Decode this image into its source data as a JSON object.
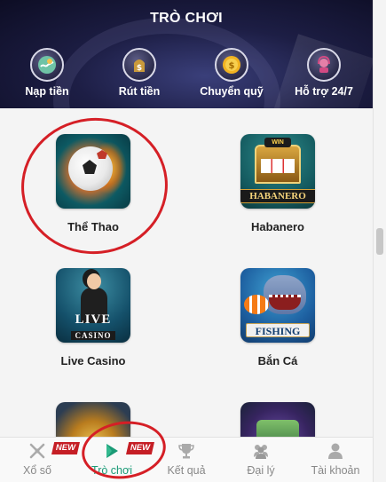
{
  "header": {
    "title": "TRÒ CHƠI",
    "actions": [
      {
        "label": "Nạp tiền",
        "icon": "deposit-icon"
      },
      {
        "label": "Rút tiền",
        "icon": "withdraw-icon"
      },
      {
        "label": "Chuyển quỹ",
        "icon": "transfer-icon"
      },
      {
        "label": "Hỗ trợ 24/7",
        "icon": "support-icon"
      }
    ]
  },
  "games": [
    {
      "name": "Thể Thao",
      "icon": "sports-icon"
    },
    {
      "name": "Habanero",
      "icon": "habanero-icon",
      "icon_text": "HABANERO",
      "icon_badge": "WIN"
    },
    {
      "name": "Live Casino",
      "icon": "live-casino-icon",
      "icon_text_1": "LIVE",
      "icon_text_2": "CASINO"
    },
    {
      "name": "Bắn Cá",
      "icon": "fishing-icon",
      "icon_text": "FISHING"
    },
    {
      "name": "",
      "icon": "game-5-icon"
    },
    {
      "name": "",
      "icon": "game-6-icon"
    }
  ],
  "nav": {
    "items": [
      {
        "label": "Xổ số",
        "icon": "lottery-icon",
        "badge": "NEW"
      },
      {
        "label": "Trò chơi",
        "icon": "play-icon",
        "badge": "NEW",
        "active": true
      },
      {
        "label": "Kết quả",
        "icon": "trophy-icon"
      },
      {
        "label": "Đại lý",
        "icon": "agents-icon"
      },
      {
        "label": "Tài khoản",
        "icon": "account-icon"
      }
    ]
  },
  "colors": {
    "header_bg": "#1d1e45",
    "accent_green": "#1a9a76",
    "badge_red": "#c51e25",
    "annotation_red": "#d51f26"
  }
}
